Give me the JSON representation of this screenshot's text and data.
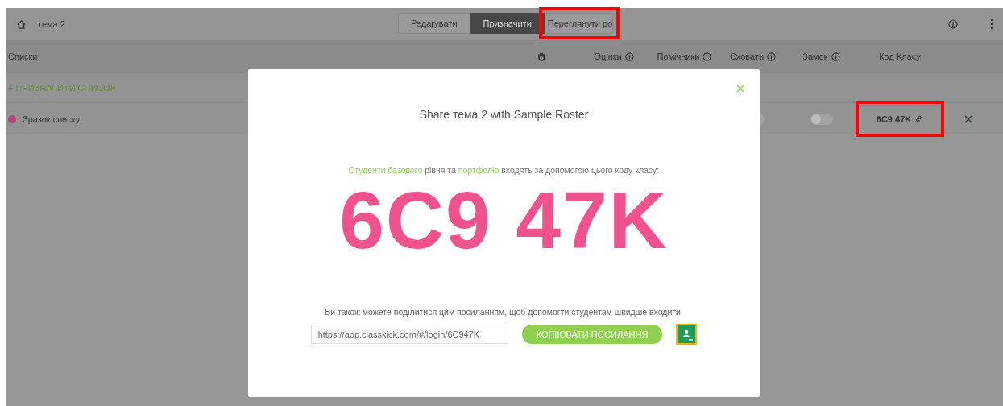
{
  "topbar": {
    "title": "тема 2",
    "tabs": [
      {
        "label": "Редагувати",
        "selected": false,
        "highlighted": false
      },
      {
        "label": "Призначити",
        "selected": true,
        "highlighted": false
      },
      {
        "label": "Переглянути ро",
        "selected": false,
        "highlighted": true
      }
    ]
  },
  "table": {
    "columns": [
      {
        "label": "Списки",
        "kind": "text"
      },
      {
        "kind": "hand"
      },
      {
        "label": "Оцінки",
        "kind": "text",
        "info": true
      },
      {
        "label": "Помічники",
        "kind": "text",
        "info": true
      },
      {
        "label": "Сховати",
        "kind": "text",
        "info": true
      },
      {
        "label": "Замок",
        "kind": "text",
        "info": true
      },
      {
        "label": "Код Класу",
        "kind": "text",
        "info": false
      }
    ],
    "add_label": "+ ПРИЗНАЧИТИ СПИСОК",
    "rows": [
      {
        "name": "Зразок списку",
        "color": "#b5467a",
        "hide_on": false,
        "lock_on": false,
        "code": "6C9 47K",
        "code_highlighted": true
      }
    ]
  },
  "modal": {
    "title": "Share тема 2 with Sample Roster",
    "intro": [
      {
        "text": "Студенти базового",
        "kind": "link"
      },
      {
        "text": "рівня та",
        "kind": "text"
      },
      {
        "text": "портфоліо",
        "kind": "link"
      },
      {
        "text": "входять за допомогою цього коду класу:",
        "kind": "text"
      }
    ],
    "code": "6C9 47K",
    "share_text": "Ви також можете поділитися цим посиланням, щоб допомогти студентам швидше входити:",
    "link_value": "https://app.classkick.com/#/login/6C947K",
    "copy_button": "КОПІЮВАТИ ПОСИЛАННЯ"
  }
}
